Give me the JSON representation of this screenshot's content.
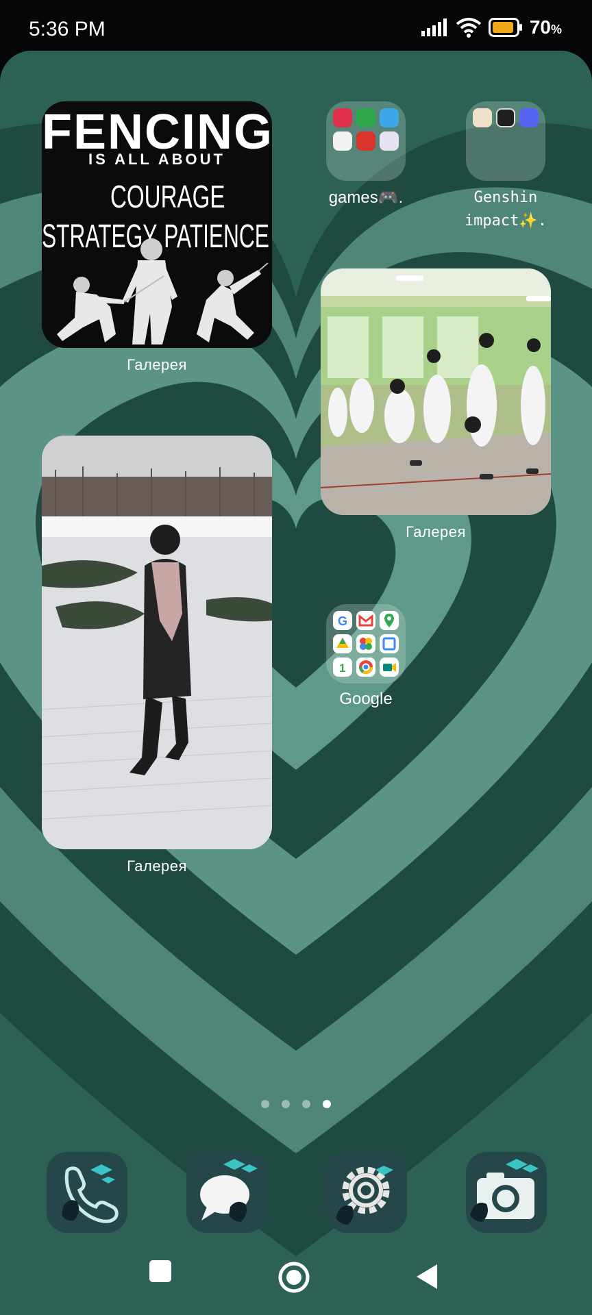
{
  "status": {
    "time": "5:36 PM",
    "battery": "70",
    "battery_unit": "%"
  },
  "widgets": {
    "poster": {
      "line1": "FENCING",
      "line2": "IS ALL ABOUT",
      "line3": "COURAGE",
      "line4": "STRATEGY",
      "line5": "PATIENCE",
      "label": "Галерея"
    },
    "gym": {
      "label": "Галерея"
    },
    "snow": {
      "label": "Галерея"
    }
  },
  "folders": {
    "games": {
      "label": "games🎮."
    },
    "genshin": {
      "label_line1": "Genshin",
      "label_line2": "impact✨."
    },
    "google": {
      "label": "Google"
    }
  },
  "pages": {
    "count": 4,
    "active": 4
  },
  "dock": [
    "phone-icon",
    "messages-icon",
    "settings-icon",
    "camera-icon"
  ],
  "nav": [
    "recents-button",
    "home-button",
    "back-button"
  ]
}
